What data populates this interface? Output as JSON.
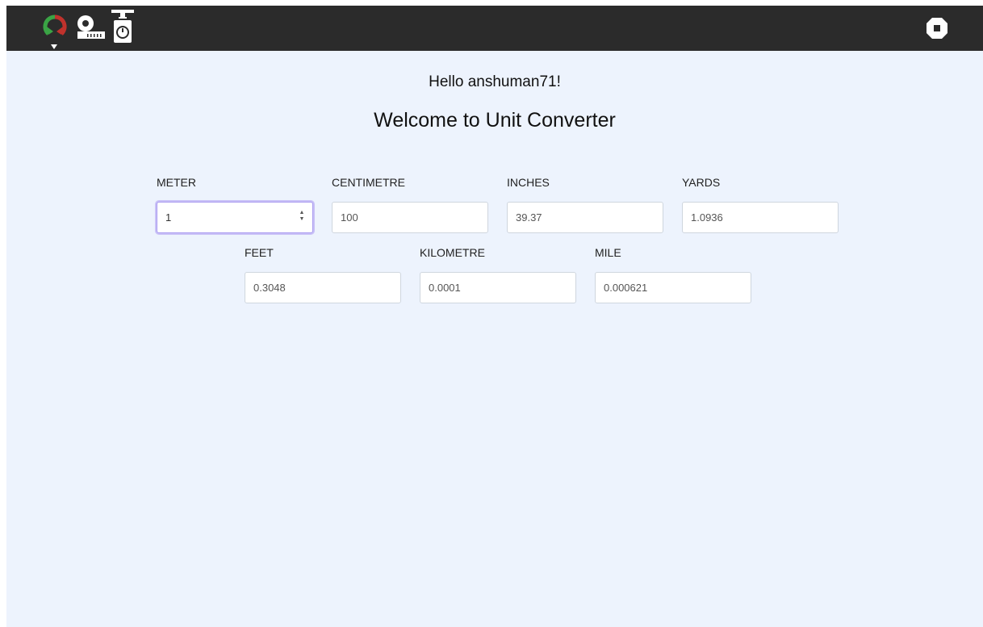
{
  "nav": {
    "icons": [
      "converter-app-icon",
      "measuring-tape-icon",
      "weighing-scale-icon",
      "logout-icon"
    ],
    "colors": {
      "bar": "#2b2b2b",
      "converter_green": "#3aa445",
      "converter_red": "#c0322c"
    }
  },
  "header": {
    "greeting": "Hello anshuman71!",
    "title": "Welcome to Unit Converter"
  },
  "fields": {
    "meter": {
      "label": "METER",
      "value": "1"
    },
    "centimetre": {
      "label": "CENTIMETRE",
      "value": "100"
    },
    "inches": {
      "label": "INCHES",
      "value": "39.37"
    },
    "yards": {
      "label": "YARDS",
      "value": "1.0936"
    },
    "feet": {
      "label": "FEET",
      "value": "0.3048"
    },
    "kilometre": {
      "label": "KILOMETRE",
      "value": "0.0001"
    },
    "mile": {
      "label": "MILE",
      "value": "0.000621"
    }
  },
  "theme": {
    "background": "#edf3fd",
    "focus_ring": "#a89af0"
  }
}
